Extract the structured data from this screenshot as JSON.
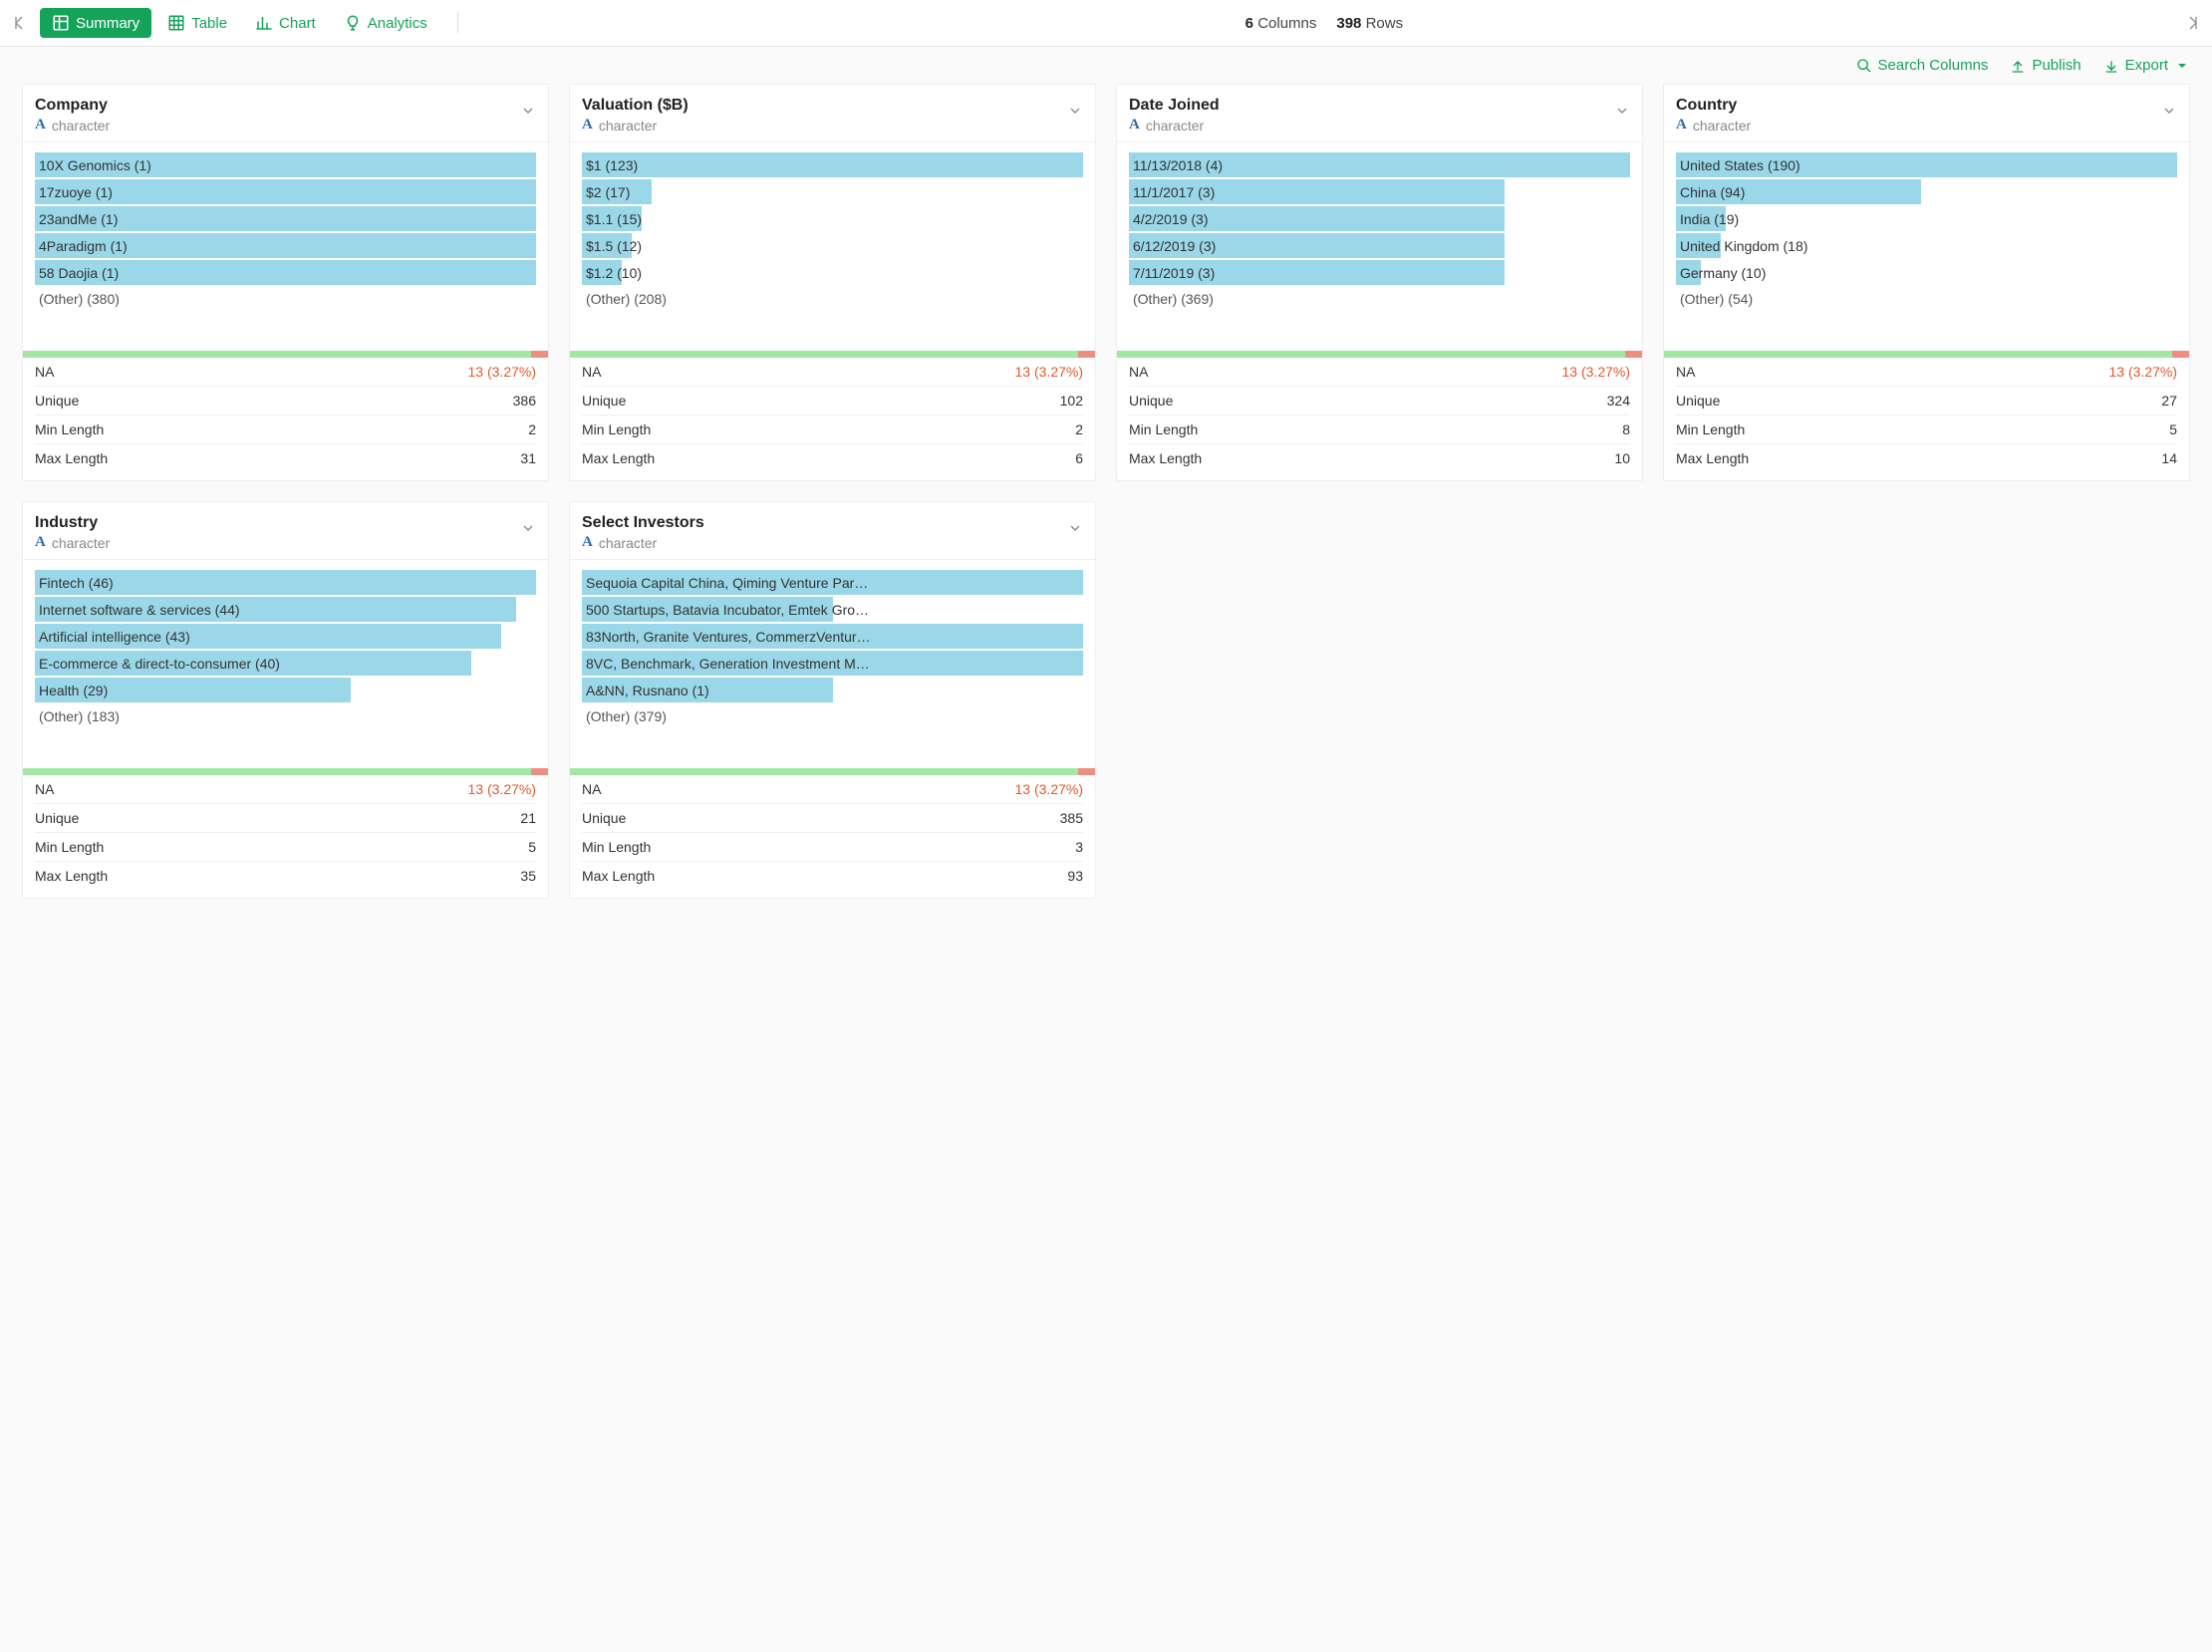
{
  "toolbar": {
    "tabs": {
      "summary": "Summary",
      "table": "Table",
      "chart": "Chart",
      "analytics": "Analytics"
    },
    "columns_count": "6",
    "columns_label": "Columns",
    "rows_count": "398",
    "rows_label": "Rows"
  },
  "actions": {
    "search": "Search Columns",
    "publish": "Publish",
    "export": "Export"
  },
  "type_label": "character",
  "chart_data": [
    {
      "title": "Company",
      "type": "bar",
      "items": [
        {
          "label": "10X Genomics (1)",
          "pct": 100
        },
        {
          "label": "17zuoye (1)",
          "pct": 100
        },
        {
          "label": "23andMe (1)",
          "pct": 100
        },
        {
          "label": "4Paradigm (1)",
          "pct": 100
        },
        {
          "label": "58 Daojia (1)",
          "pct": 100
        }
      ],
      "other": "(Other) (380)",
      "na_pct": 3.27,
      "stats": {
        "NA": "13 (3.27%)",
        "Unique": "386",
        "Min Length": "2",
        "Max Length": "31"
      }
    },
    {
      "title": "Valuation ($B)",
      "type": "bar",
      "items": [
        {
          "label": "$1 (123)",
          "pct": 100
        },
        {
          "label": "$2 (17)",
          "pct": 14
        },
        {
          "label": "$1.1 (15)",
          "pct": 12
        },
        {
          "label": "$1.5 (12)",
          "pct": 10
        },
        {
          "label": "$1.2 (10)",
          "pct": 8
        }
      ],
      "other": "(Other) (208)",
      "na_pct": 3.27,
      "stats": {
        "NA": "13 (3.27%)",
        "Unique": "102",
        "Min Length": "2",
        "Max Length": "6"
      }
    },
    {
      "title": "Date Joined",
      "type": "bar",
      "items": [
        {
          "label": "11/13/2018 (4)",
          "pct": 100
        },
        {
          "label": "11/1/2017 (3)",
          "pct": 75
        },
        {
          "label": "4/2/2019 (3)",
          "pct": 75
        },
        {
          "label": "6/12/2019 (3)",
          "pct": 75
        },
        {
          "label": "7/11/2019 (3)",
          "pct": 75
        }
      ],
      "other": "(Other) (369)",
      "na_pct": 3.27,
      "stats": {
        "NA": "13 (3.27%)",
        "Unique": "324",
        "Min Length": "8",
        "Max Length": "10"
      }
    },
    {
      "title": "Country",
      "type": "bar",
      "items": [
        {
          "label": "United States (190)",
          "pct": 100
        },
        {
          "label": "China (94)",
          "pct": 49
        },
        {
          "label": "India (19)",
          "pct": 10
        },
        {
          "label": "United Kingdom (18)",
          "pct": 9
        },
        {
          "label": "Germany (10)",
          "pct": 5
        }
      ],
      "other": "(Other) (54)",
      "na_pct": 3.27,
      "stats": {
        "NA": "13 (3.27%)",
        "Unique": "27",
        "Min Length": "5",
        "Max Length": "14"
      }
    },
    {
      "title": "Industry",
      "type": "bar",
      "items": [
        {
          "label": "Fintech (46)",
          "pct": 100
        },
        {
          "label": "Internet software & services (44)",
          "pct": 96
        },
        {
          "label": "Artificial intelligence (43)",
          "pct": 93
        },
        {
          "label": "E-commerce & direct-to-consumer (40)",
          "pct": 87
        },
        {
          "label": "Health (29)",
          "pct": 63
        }
      ],
      "other": "(Other) (183)",
      "na_pct": 3.27,
      "stats": {
        "NA": "13 (3.27%)",
        "Unique": "21",
        "Min Length": "5",
        "Max Length": "35"
      }
    },
    {
      "title": "Select Investors",
      "type": "bar",
      "items": [
        {
          "label": "Sequoia Capital China, Qiming Venture Par…",
          "pct": 100
        },
        {
          "label": "500 Startups, Batavia Incubator, Emtek Gro…",
          "pct": 50
        },
        {
          "label": "83North, Granite Ventures, CommerzVentur…",
          "pct": 100
        },
        {
          "label": "8VC, Benchmark, Generation Investment M…",
          "pct": 100
        },
        {
          "label": "A&NN, Rusnano (1)",
          "pct": 50
        }
      ],
      "other": "(Other) (379)",
      "na_pct": 3.27,
      "stats": {
        "NA": "13 (3.27%)",
        "Unique": "385",
        "Min Length": "3",
        "Max Length": "93"
      }
    }
  ],
  "stat_labels": {
    "na": "NA",
    "unique": "Unique",
    "min": "Min Length",
    "max": "Max Length"
  }
}
